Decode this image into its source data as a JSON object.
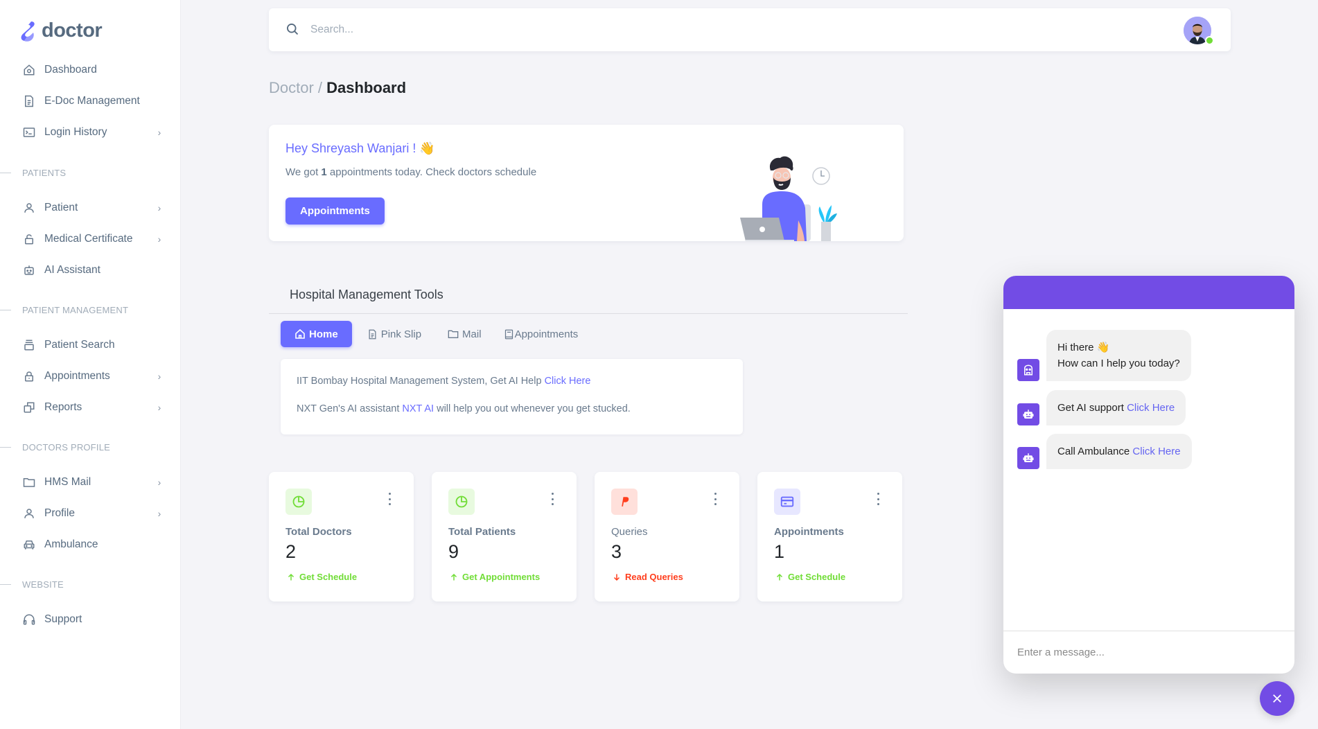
{
  "brand": {
    "name": "doctor",
    "accent": "#696cff",
    "chat_accent": "#724ce5"
  },
  "sidebar": {
    "items": [
      {
        "label": "Dashboard",
        "icon": "home-icon",
        "has_submenu": false
      },
      {
        "label": "E-Doc Management",
        "icon": "file-text-icon",
        "has_submenu": false
      },
      {
        "label": "Login History",
        "icon": "terminal-icon",
        "has_submenu": true
      }
    ],
    "sections": [
      {
        "title": "PATIENTS",
        "items": [
          {
            "label": "Patient",
            "icon": "user-icon",
            "has_submenu": true
          },
          {
            "label": "Medical Certificate",
            "icon": "lock-open-icon",
            "has_submenu": true
          },
          {
            "label": "AI Assistant",
            "icon": "robot-icon",
            "has_submenu": false
          }
        ]
      },
      {
        "title": "PATIENT MANAGEMENT",
        "items": [
          {
            "label": "Patient Search",
            "icon": "archive-icon",
            "has_submenu": false
          },
          {
            "label": "Appointments",
            "icon": "lock-icon",
            "has_submenu": true
          },
          {
            "label": "Reports",
            "icon": "copy-icon",
            "has_submenu": true
          }
        ]
      },
      {
        "title": "DOCTORS PROFILE",
        "items": [
          {
            "label": "HMS Mail",
            "icon": "folder-icon",
            "has_submenu": true
          },
          {
            "label": "Profile",
            "icon": "user-icon",
            "has_submenu": true
          },
          {
            "label": "Ambulance",
            "icon": "car-icon",
            "has_submenu": false
          }
        ]
      },
      {
        "title": "WEBSITE",
        "items": [
          {
            "label": "Support",
            "icon": "headphones-icon",
            "has_submenu": false
          }
        ]
      }
    ],
    "chevron": "›"
  },
  "topbar": {
    "search_placeholder": "Search...",
    "user_status": "online"
  },
  "breadcrumb": {
    "parent": "Doctor",
    "separator": " / ",
    "current": "Dashboard"
  },
  "welcome": {
    "greeting": "Hey Shreyash Wanjari ! 👋",
    "text_before": "We got ",
    "count": "1",
    "text_after": " appointments today. Check doctors schedule",
    "button_label": "Appointments"
  },
  "tools": {
    "title": "Hospital Management Tools",
    "tabs": [
      {
        "label": "Home",
        "icon": "home-icon",
        "active": true
      },
      {
        "label": "Pink Slip",
        "icon": "file-text-icon",
        "active": false
      },
      {
        "label": "Mail",
        "icon": "folder-icon",
        "active": false
      },
      {
        "label": "Appointments",
        "icon": "book-icon",
        "active": false
      }
    ],
    "info": {
      "line1_text": "IIT Bombay Hospital Management System, Get AI Help ",
      "line1_link": "Click Here",
      "line2_before": "NXT Gen's AI assistant ",
      "line2_link": "NXT AI",
      "line2_after": " will help you out whenever you get stucked."
    }
  },
  "stats": [
    {
      "title": "Total Doctors",
      "value": "2",
      "link": "Get Schedule",
      "trend": "up",
      "icon": "pie-chart-icon",
      "color": "#71dd37",
      "bg": "#e8fadf",
      "bold": true
    },
    {
      "title": "Total Patients",
      "value": "9",
      "link": "Get Appointments",
      "trend": "up",
      "icon": "pie-chart-icon",
      "color": "#71dd37",
      "bg": "#e8fadf",
      "bold": true
    },
    {
      "title": "Queries",
      "value": "3",
      "link": "Read Queries",
      "trend": "down",
      "icon": "paypal-icon",
      "color": "#ff3e1d",
      "bg": "#ffe0db",
      "bold": false
    },
    {
      "title": "Appointments",
      "value": "1",
      "link": "Get Schedule",
      "trend": "up",
      "icon": "credit-card-icon",
      "color": "#696cff",
      "bg": "#e7e7ff",
      "bold": true
    }
  ],
  "chat": {
    "messages": [
      {
        "line1": "Hi there 👋",
        "line2": "How can I help you today?"
      },
      {
        "text": "Get AI support ",
        "link": "Click Here"
      },
      {
        "text": "Call Ambulance ",
        "link": "Click Here"
      }
    ],
    "input_placeholder": "Enter a message..."
  }
}
